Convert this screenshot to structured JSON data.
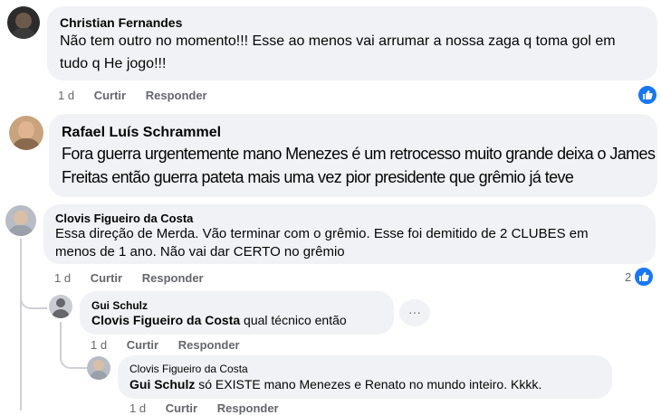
{
  "comments": [
    {
      "author": "Christian Fernandes",
      "text_line1": "Não tem outro no momento!!! Esse ao menos vai arrumar a nossa zaga q toma gol em",
      "text_line2": "tudo q He jogo!!!",
      "time": "1 d",
      "like": "Curtir",
      "reply": "Responder"
    },
    {
      "author": "Rafael Luís Schrammel",
      "text_line1": "Fora guerra urgentemente mano Menezes é um retrocesso muito grande deixa o James",
      "text_line2": "Freitas então guerra pateta mais uma vez pior presidente que grêmio já teve"
    },
    {
      "author": "Clovis Figueiro da Costa",
      "text_line1": "Essa direção de Merda. Vão terminar com o grêmio. Esse foi demitido de 2 CLUBES em",
      "text_line2": "menos de 1 ano. Não vai dar CERTO no grêmio",
      "time": "1 d",
      "like": "Curtir",
      "reply": "Responder",
      "reaction_count": "2"
    }
  ],
  "replies": [
    {
      "author": "Gui Schulz",
      "mention": "Clovis Figueiro da Costa",
      "text": " qual técnico então",
      "time": "1 d",
      "like": "Curtir",
      "reply": "Responder",
      "more": "···"
    },
    {
      "author": "Clovis Figueiro da Costa",
      "mention": "Gui Schulz",
      "text": " só EXISTE mano Menezes e Renato no mundo inteiro. Kkkk.",
      "time": "1 d",
      "like": "Curtir",
      "reply": "Responder"
    }
  ],
  "colors": {
    "bubble": "#f0f2f5",
    "meta": "#65676b",
    "like_blue": "#1877f2"
  }
}
